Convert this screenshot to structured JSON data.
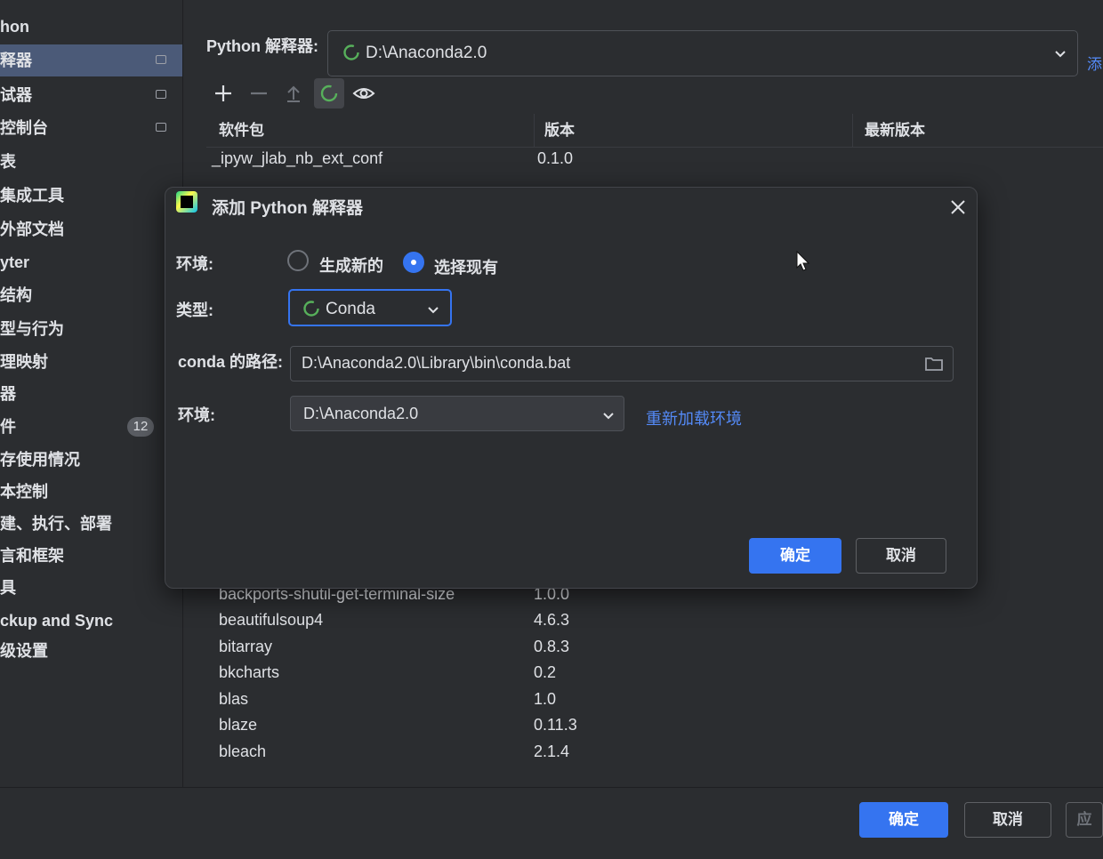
{
  "sidebar": {
    "items": [
      {
        "label": "hon"
      },
      {
        "label": "释器"
      },
      {
        "label": "试器"
      },
      {
        "label": "控制台"
      },
      {
        "label": "表"
      },
      {
        "label": "集成工具"
      },
      {
        "label": "外部文档"
      },
      {
        "label": "yter"
      },
      {
        "label": "结构"
      },
      {
        "label": "型与行为"
      },
      {
        "label": "理映射"
      },
      {
        "label": "器"
      },
      {
        "label": "件",
        "badge": "12"
      },
      {
        "label": "存使用情况"
      },
      {
        "label": "本控制"
      },
      {
        "label": "建、执行、部署"
      },
      {
        "label": "言和框架"
      },
      {
        "label": "具"
      },
      {
        "label": "ckup and Sync"
      },
      {
        "label": "级设置"
      }
    ]
  },
  "interpreter": {
    "label": "Python 解释器:",
    "value": "D:\\Anaconda2.0",
    "add_link": "添"
  },
  "toolbar": {
    "icons": [
      "plus-icon",
      "minus-icon",
      "upload-icon",
      "conda-spinner-icon",
      "eye-icon"
    ]
  },
  "packages": {
    "headers": {
      "package": "软件包",
      "version": "版本",
      "latest": "最新版本"
    },
    "top_row": {
      "name": "_ipyw_jlab_nb_ext_conf",
      "version": "0.1.0"
    },
    "rows": [
      {
        "name": "backports-shutil-get-terminal-size",
        "version": "1.0.0"
      },
      {
        "name": "beautifulsoup4",
        "version": "4.6.3"
      },
      {
        "name": "bitarray",
        "version": "0.8.3"
      },
      {
        "name": "bkcharts",
        "version": "0.2"
      },
      {
        "name": "blas",
        "version": "1.0"
      },
      {
        "name": "blaze",
        "version": "0.11.3"
      },
      {
        "name": "bleach",
        "version": "2.1.4"
      }
    ]
  },
  "dialog": {
    "title": "添加 Python 解释器",
    "env_label": "环境:",
    "radio_new": "生成新的",
    "radio_existing": "选择现有",
    "type_label": "类型:",
    "type_value": "Conda",
    "conda_path_label": "conda 的路径:",
    "conda_path_value": "D:\\Anaconda2.0\\Library\\bin\\conda.bat",
    "env2_label": "环境:",
    "env_value": "D:\\Anaconda2.0",
    "reload_link": "重新加载环境",
    "ok": "确定",
    "cancel": "取消"
  },
  "footer": {
    "ok": "确定",
    "cancel": "取消",
    "apply": "应"
  }
}
